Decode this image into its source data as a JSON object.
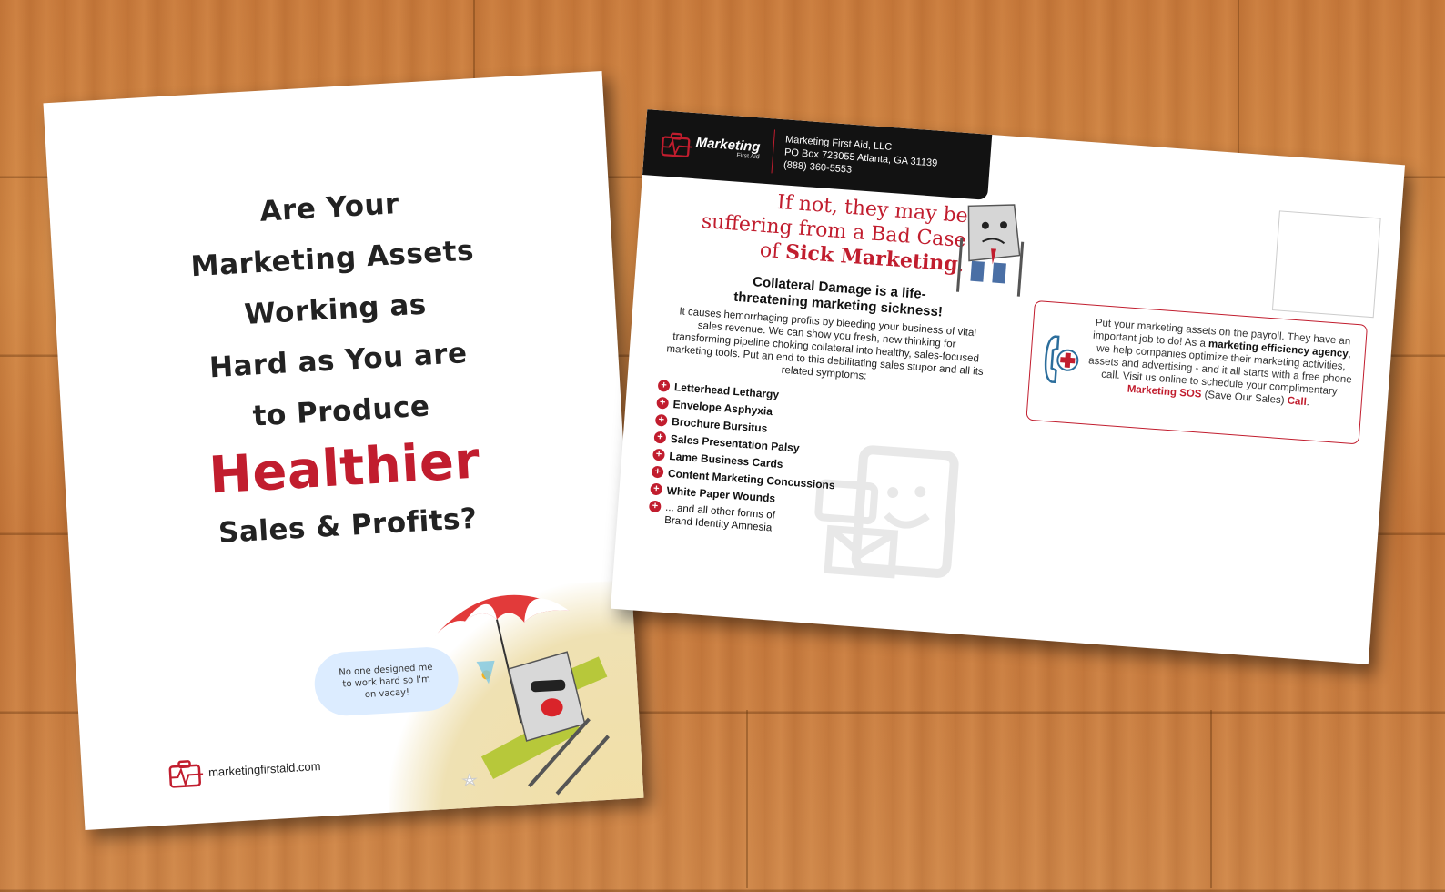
{
  "front": {
    "headline_lines": [
      "Are Your",
      "Marketing Assets",
      "Working as",
      "Hard as You are",
      "to Produce"
    ],
    "headline_emphasis": "Healthier",
    "headline_end": "Sales & Profits?",
    "bubble_text": "No one designed me to work hard so I'm on vacay!",
    "website": "marketingfirstaid.com"
  },
  "back": {
    "brand": {
      "name": "Marketing",
      "sub": "First Aid"
    },
    "company": "Marketing First Aid, LLC",
    "address": "PO Box 723055 Atlanta, GA 31139",
    "phone": "(888) 360-5553",
    "title_plain": "If not, they may be suffering from a Bad Case of ",
    "title_bold": "Sick Marketing",
    "title_end": ".",
    "subheading": "Collateral Damage is a life-threatening marketing sickness!",
    "body": "It causes hemorrhaging profits by bleeding your business of vital sales revenue. We can show you fresh, new thinking for transforming pipeline choking collateral into healthy, sales-focused marketing tools. Put an end to this debilitating sales stupor and all its related symptoms:",
    "symptoms": [
      "Letterhead Lethargy",
      "Envelope Asphyxia",
      "Brochure Bursitus",
      "Sales Presentation Palsy",
      "Lame Business Cards",
      "Content Marketing Concussions",
      "White Paper Wounds"
    ],
    "symptoms_last": "... and all other forms of Brand Identity Amnesia",
    "call": {
      "p1": "Put your marketing assets on the payroll. They have an important job to do! As a ",
      "p1_bold": "marketing efficiency agency",
      "p2": ", we help companies optimize their marketing activities, assets and advertising - and it all starts with a free phone call. Visit us online to schedule your complimentary ",
      "sos": "Marketing SOS",
      "p3": " (Save Our Sales) ",
      "call_word": "Call",
      "end": "."
    }
  },
  "colors": {
    "brand_red": "#c11d2e",
    "header_black": "#121212",
    "wood": "#cc7f40"
  }
}
